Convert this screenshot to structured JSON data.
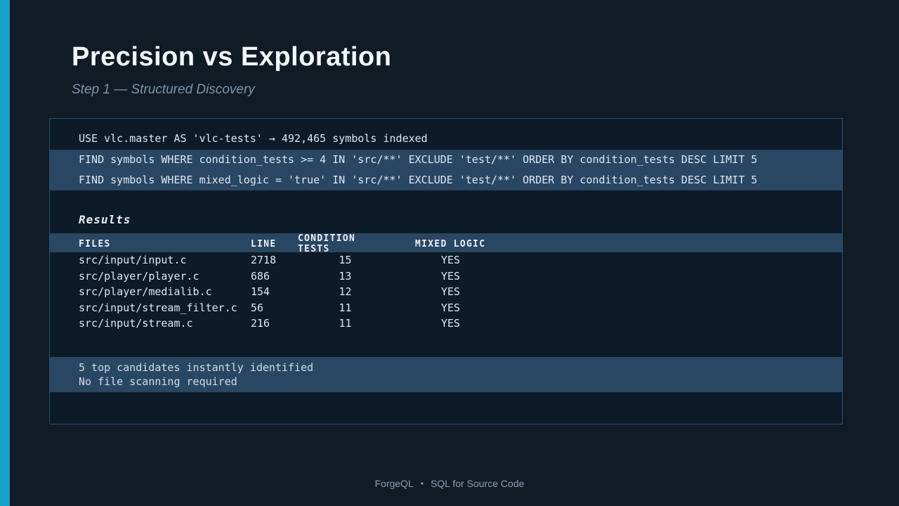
{
  "colors": {
    "accent_bar": "#16a2c6",
    "highlight_band": "#294663",
    "panel_border": "#2d4e72",
    "background": "#101b25"
  },
  "header": {
    "title": "Precision vs Exploration",
    "subtitle": "Step 1 — Structured Discovery"
  },
  "terminal": {
    "use_line": "USE vlc.master AS 'vlc-tests' → 492,465 symbols indexed",
    "queries": [
      "FIND symbols WHERE condition_tests >= 4 IN 'src/**' EXCLUDE 'test/**' ORDER BY condition_tests DESC LIMIT 5",
      "FIND symbols WHERE mixed_logic = 'true' IN 'src/**' EXCLUDE 'test/**' ORDER BY condition_tests DESC LIMIT 5"
    ],
    "results_label": "Results",
    "table": {
      "columns": [
        "FILES",
        "LINE",
        "CONDITION TESTS",
        "MIXED LOGIC"
      ],
      "rows": [
        {
          "file": "src/input/input.c",
          "line": "2718",
          "condition_tests": "15",
          "mixed_logic": "YES"
        },
        {
          "file": "src/player/player.c",
          "line": "686",
          "condition_tests": "13",
          "mixed_logic": "YES"
        },
        {
          "file": "src/player/medialib.c",
          "line": "154",
          "condition_tests": "12",
          "mixed_logic": "YES"
        },
        {
          "file": "src/input/stream_filter.c",
          "line": "56",
          "condition_tests": "11",
          "mixed_logic": "YES"
        },
        {
          "file": "src/input/stream.c",
          "line": "216",
          "condition_tests": "11",
          "mixed_logic": "YES"
        }
      ]
    },
    "summary_lines": [
      "5 top candidates instantly identified",
      "No file scanning required"
    ]
  },
  "footer": {
    "brand": "ForgeQL",
    "separator": "•",
    "tagline": "SQL for Source Code"
  }
}
